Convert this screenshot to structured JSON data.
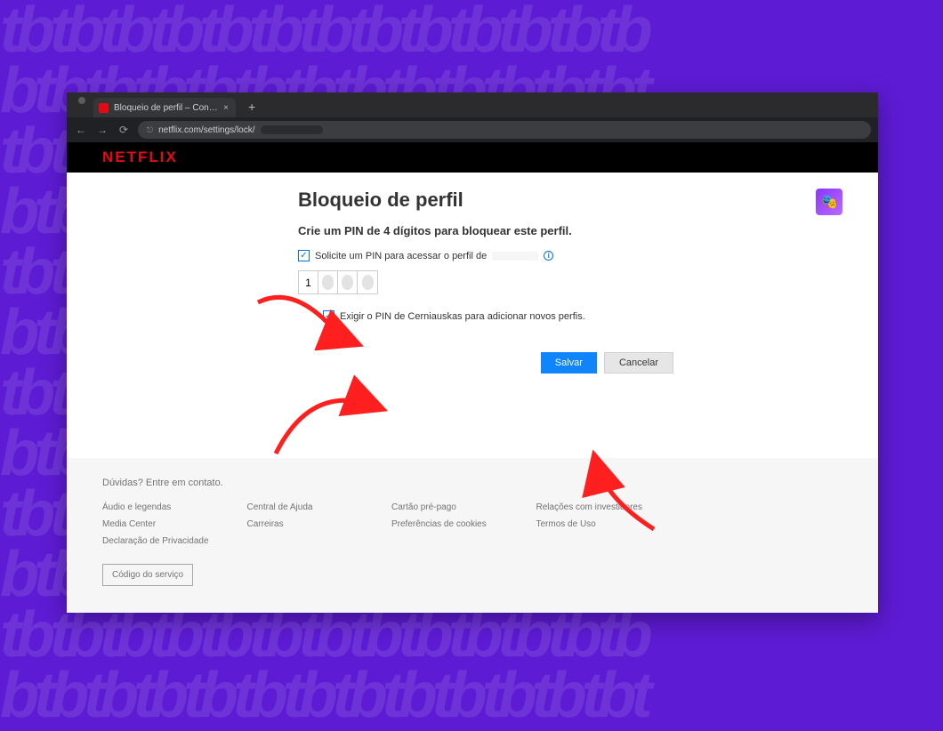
{
  "browser": {
    "tab_title": "Bloqueio de perfil – Conta – Ne",
    "url_display": "netflix.com/settings/lock/"
  },
  "header": {
    "logo_text": "NETFLIX"
  },
  "page": {
    "title": "Bloqueio de perfil",
    "subtitle": "Crie um PIN de 4 dígitos para bloquear este perfil.",
    "checkbox1": {
      "checked": true,
      "label_prefix": "Solicite um PIN para acessar o perfil de",
      "info_glyph": "i"
    },
    "pin": {
      "digit1": "1",
      "digit2": "",
      "digit3": "",
      "digit4": ""
    },
    "checkbox2": {
      "checked": true,
      "label": "Exigir o PIN de Cerniauskas para adicionar novos perfis."
    },
    "buttons": {
      "save": "Salvar",
      "cancel": "Cancelar"
    }
  },
  "footer": {
    "top": "Dúvidas? Entre em contato.",
    "links": {
      "c0r0": "Áudio e legendas",
      "c1r0": "Central de Ajuda",
      "c2r0": "Cartão pré-pago",
      "c3r0": "Relações com investidores",
      "c0r1": "Media Center",
      "c1r1": "Carreiras",
      "c2r1": "Preferências de cookies",
      "c3r1": "Termos de Uso",
      "c0r2": "Declaração de Privacidade"
    },
    "service_code": "Código do serviço"
  },
  "avatar_glyph": "🎭"
}
